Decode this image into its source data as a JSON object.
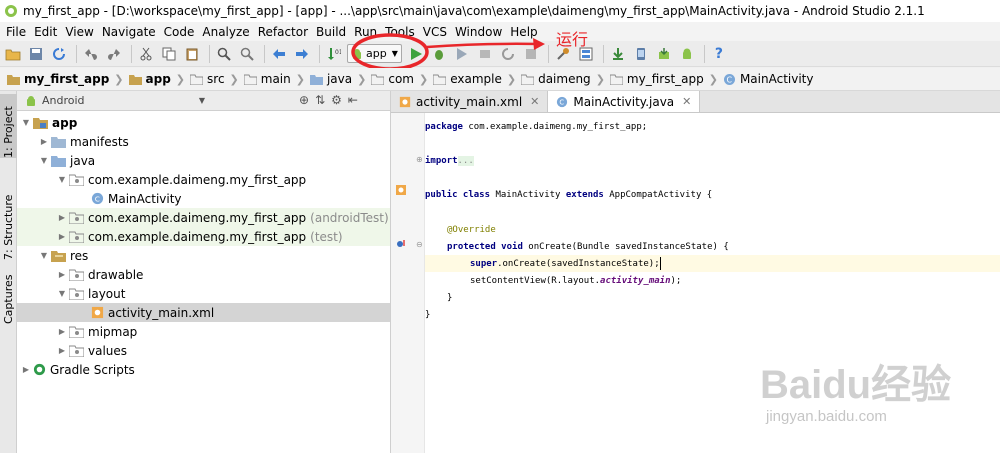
{
  "window": {
    "title": "my_first_app - [D:\\workspace\\my_first_app] - [app] - ...\\app\\src\\main\\java\\com\\example\\daimeng\\my_first_app\\MainActivity.java - Android Studio 2.1.1"
  },
  "menu": [
    "File",
    "Edit",
    "View",
    "Navigate",
    "Code",
    "Analyze",
    "Refactor",
    "Build",
    "Run",
    "Tools",
    "VCS",
    "Window",
    "Help"
  ],
  "toolbar": {
    "run_config_label": "app",
    "annotation_label": "运行"
  },
  "breadcrumbs": [
    "my_first_app",
    "app",
    "src",
    "main",
    "java",
    "com",
    "example",
    "daimeng",
    "my_first_app",
    "MainActivity"
  ],
  "side_tabs": [
    "1: Project",
    "7: Structure",
    "Captures"
  ],
  "project_panel": {
    "view_label": "Android"
  },
  "tree": [
    {
      "label": "app",
      "suffix": ""
    },
    {
      "label": "manifests",
      "suffix": ""
    },
    {
      "label": "java",
      "suffix": ""
    },
    {
      "label": "com.example.daimeng.my_first_app",
      "suffix": ""
    },
    {
      "label": "MainActivity",
      "suffix": ""
    },
    {
      "label": "com.example.daimeng.my_first_app",
      "suffix": "(androidTest)"
    },
    {
      "label": "com.example.daimeng.my_first_app",
      "suffix": "(test)"
    },
    {
      "label": "res",
      "suffix": ""
    },
    {
      "label": "drawable",
      "suffix": ""
    },
    {
      "label": "layout",
      "suffix": ""
    },
    {
      "label": "activity_main.xml",
      "suffix": ""
    },
    {
      "label": "mipmap",
      "suffix": ""
    },
    {
      "label": "values",
      "suffix": ""
    },
    {
      "label": "Gradle Scripts",
      "suffix": ""
    }
  ],
  "editor_tabs": [
    "activity_main.xml",
    "MainActivity.java"
  ],
  "code": {
    "l1_kw": "package",
    "l1_rest": " com.example.daimeng.my_first_app;",
    "l2_kw": "import",
    "l2_rest": "...",
    "l3_kw": "public class",
    "l3_name": " MainActivity ",
    "l3_kw2": "extends",
    "l3_rest": " AppCompatActivity {",
    "l4_ann": "@Override",
    "l5_kw": "protected void",
    "l5_rest": " onCreate(Bundle savedInstanceState) {",
    "l6_kw": "super",
    "l6_rest": ".onCreate(savedInstanceState);",
    "l7_a": "setContentView(R.layout.",
    "l7_fld": "activity_main",
    "l7_b": ");",
    "l8": "}",
    "l9": "}"
  },
  "watermark": {
    "logo": "Baidu经验",
    "url": "jingyan.baidu.com"
  }
}
